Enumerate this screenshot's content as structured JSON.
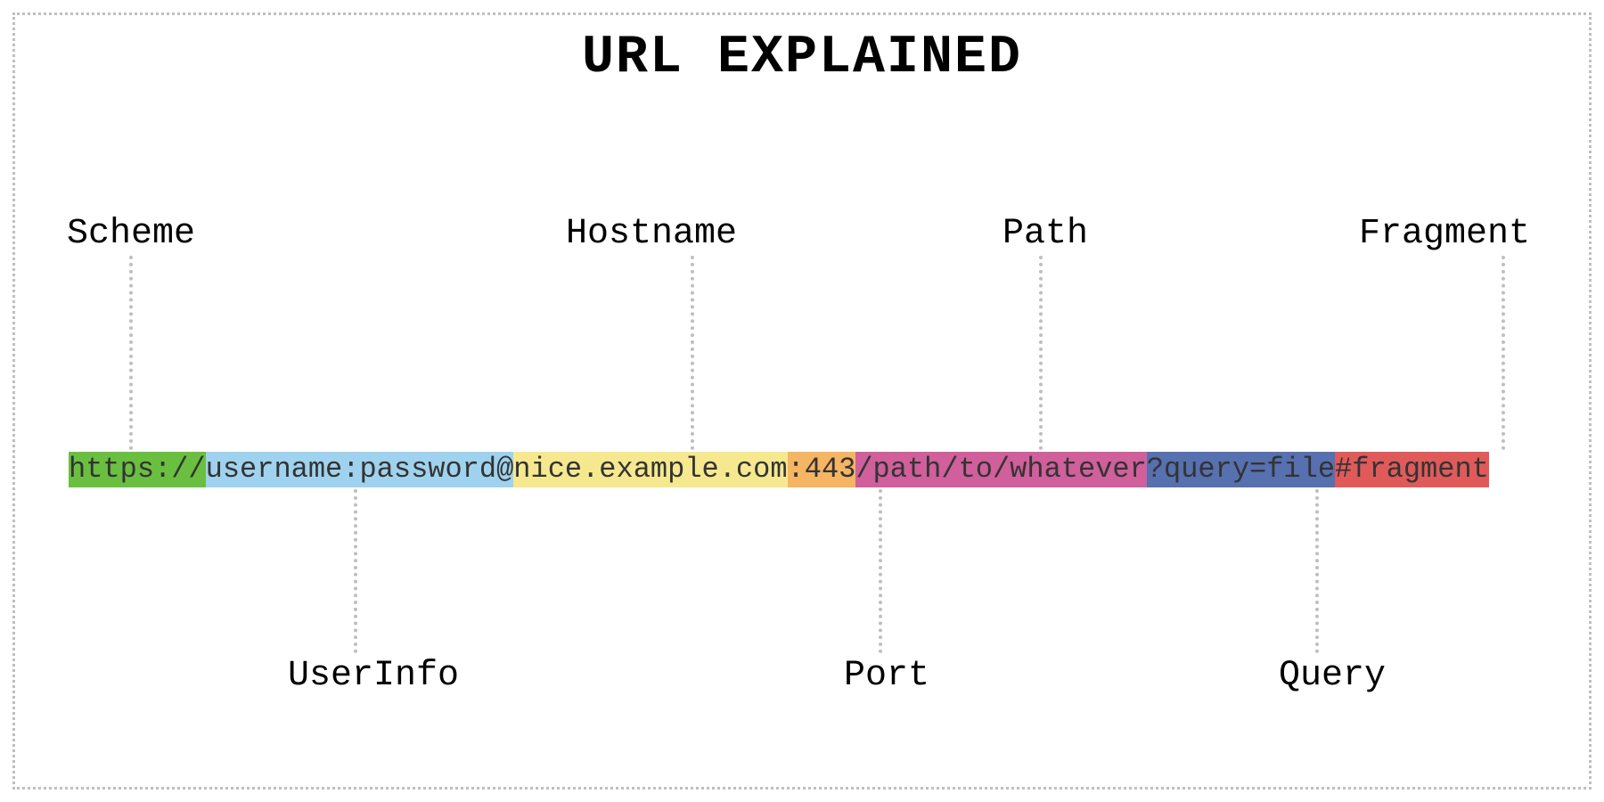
{
  "title": "URL EXPLAINED",
  "url_parts": {
    "scheme": "https://",
    "userinfo": "username:password@",
    "hostname": "nice.example.com",
    "port": ":443",
    "path": "/path/to/whatever",
    "query": "?query=file",
    "fragment": "#fragment"
  },
  "labels": {
    "scheme": "Scheme",
    "userinfo": "UserInfo",
    "hostname": "Hostname",
    "port": "Port",
    "path": "Path",
    "query": "Query",
    "fragment": "Fragment"
  },
  "colors": {
    "scheme": "#6abf40",
    "userinfo": "#9fd2ee",
    "hostname": "#f6e88f",
    "port": "#f5b562",
    "path": "#d05f9c",
    "query": "#5670b0",
    "fragment": "#e05a5a"
  }
}
